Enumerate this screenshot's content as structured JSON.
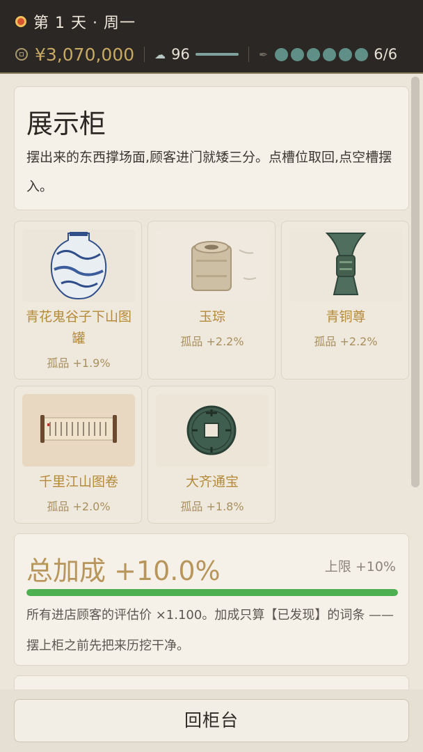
{
  "status": {
    "day_label": "第 1 天 · 周一",
    "money": "¥3,070,000",
    "reputation": "96",
    "reputation_fraction": 1.0,
    "slots_text": "6/6",
    "slot_dots": 6
  },
  "intro": {
    "title": "展示柜",
    "description": "摆出来的东西撑场面,顾客进门就矮三分。点槽位取回,点空槽摆入。"
  },
  "items": [
    {
      "name": "青花鬼谷子下山图罐",
      "bonus": "孤品 +1.9%"
    },
    {
      "name": "玉琮",
      "bonus": "孤品 +2.2%"
    },
    {
      "name": "青铜尊",
      "bonus": "孤品 +2.2%"
    },
    {
      "name": "千里江山图卷",
      "bonus": "孤品 +2.0%"
    },
    {
      "name": "大齐通宝",
      "bonus": "孤品 +1.8%"
    }
  ],
  "total": {
    "title": "总加成 +10.0%",
    "limit": "上限 +10%",
    "fill_fraction": 1.0,
    "description": "所有进店顾客的评估价 ×1.100。加成只算【已发现】的词条 —— 摆上柜之前先把来历挖干净。"
  },
  "back_button": "回柜台",
  "colors": {
    "accent_gold": "#b48a3a",
    "progress_green": "#4caf50",
    "slot_dot": "#5f8f86"
  }
}
